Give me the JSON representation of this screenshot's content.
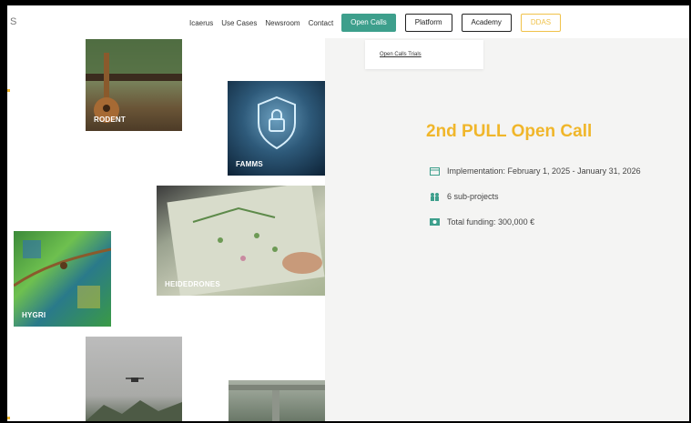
{
  "header": {
    "logo_text": "S",
    "nav": {
      "icaerus": "Icaerus",
      "use_cases": "Use Cases",
      "newsroom": "Newsroom",
      "contact": "Contact",
      "open_calls": "Open Calls",
      "platform": "Platform",
      "academy": "Academy",
      "ddas": "DDAS"
    }
  },
  "dropdown": {
    "item": "Open Calls Trials"
  },
  "tiles": [
    {
      "label": "RODENT"
    },
    {
      "label": "FAMMS"
    },
    {
      "label": "HEIDEDRONES"
    },
    {
      "label": "HYGRI"
    }
  ],
  "call": {
    "title": "2nd PULL Open Call",
    "implementation": "Implementation: February 1, 2025 - January 31, 2026",
    "subprojects": "6 sub-projects",
    "funding": "Total funding: 300,000 €"
  },
  "colors": {
    "accent": "#f0b62a",
    "teal": "#3d9f8c"
  }
}
